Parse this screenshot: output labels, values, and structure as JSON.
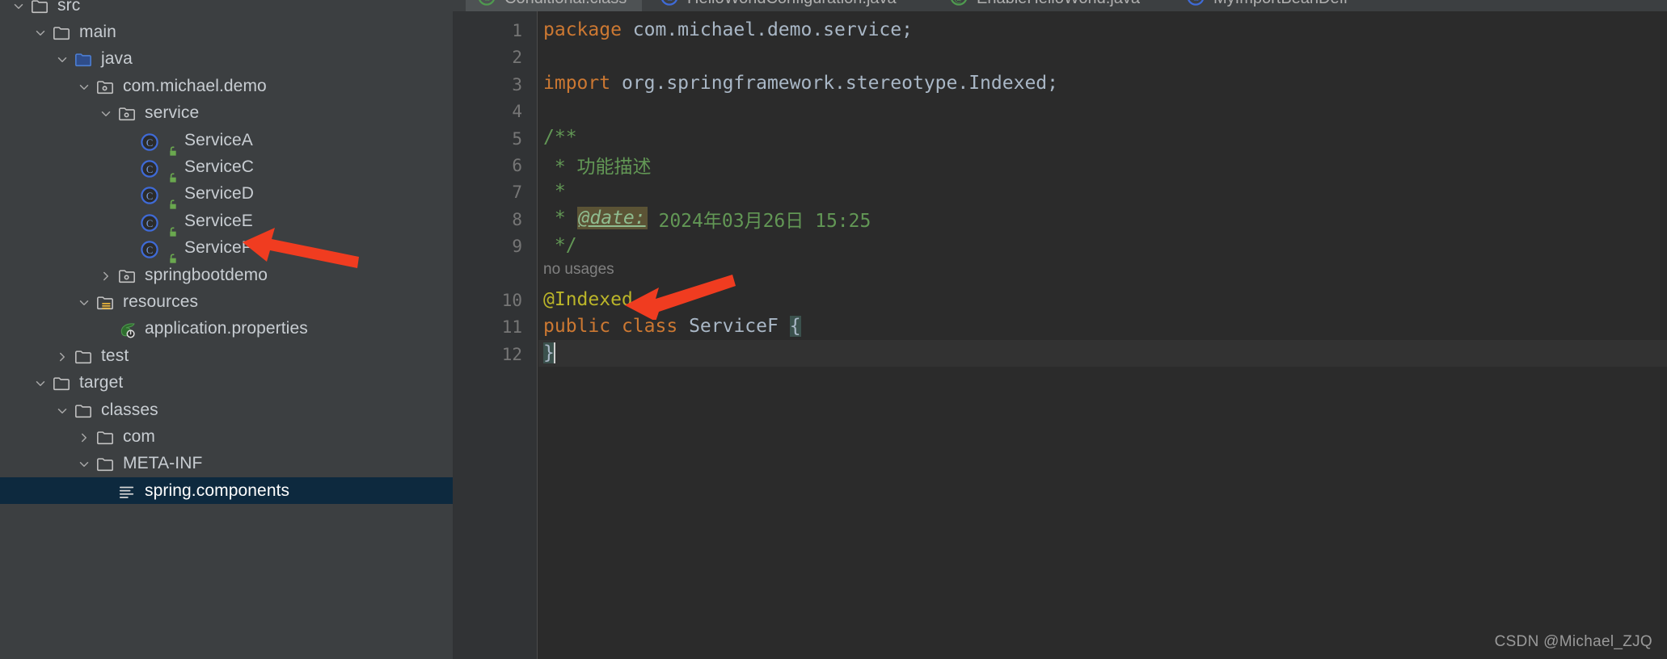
{
  "sidebar": {
    "name": "project-tree",
    "items": [
      {
        "label": "src",
        "indent": 0,
        "chevron": "down",
        "icon": "folder",
        "lock": false,
        "selected": false
      },
      {
        "label": "main",
        "indent": 1,
        "chevron": "down",
        "icon": "folder",
        "lock": false,
        "selected": false
      },
      {
        "label": "java",
        "indent": 2,
        "chevron": "down",
        "icon": "folder-source",
        "lock": false,
        "selected": false
      },
      {
        "label": "com.michael.demo",
        "indent": 3,
        "chevron": "down",
        "icon": "package",
        "lock": false,
        "selected": false
      },
      {
        "label": "service",
        "indent": 4,
        "chevron": "down",
        "icon": "package",
        "lock": false,
        "selected": false
      },
      {
        "label": "ServiceA",
        "indent": 5,
        "chevron": "none",
        "icon": "java-class",
        "lock": true,
        "selected": false
      },
      {
        "label": "ServiceC",
        "indent": 5,
        "chevron": "none",
        "icon": "java-class",
        "lock": true,
        "selected": false
      },
      {
        "label": "ServiceD",
        "indent": 5,
        "chevron": "none",
        "icon": "java-class",
        "lock": true,
        "selected": false
      },
      {
        "label": "ServiceE",
        "indent": 5,
        "chevron": "none",
        "icon": "java-class",
        "lock": true,
        "selected": false
      },
      {
        "label": "ServiceF",
        "indent": 5,
        "chevron": "none",
        "icon": "java-class",
        "lock": true,
        "selected": false
      },
      {
        "label": "springbootdemo",
        "indent": 4,
        "chevron": "right",
        "icon": "package",
        "lock": false,
        "selected": false
      },
      {
        "label": "resources",
        "indent": 3,
        "chevron": "down",
        "icon": "folder-resource",
        "lock": false,
        "selected": false
      },
      {
        "label": "application.properties",
        "indent": 4,
        "chevron": "none",
        "icon": "spring-leaf",
        "lock": false,
        "selected": false
      },
      {
        "label": "test",
        "indent": 2,
        "chevron": "right",
        "icon": "folder",
        "lock": false,
        "selected": false
      },
      {
        "label": "target",
        "indent": 1,
        "chevron": "down",
        "icon": "folder",
        "lock": false,
        "selected": false
      },
      {
        "label": "classes",
        "indent": 2,
        "chevron": "down",
        "icon": "folder",
        "lock": false,
        "selected": false
      },
      {
        "label": "com",
        "indent": 3,
        "chevron": "right",
        "icon": "folder",
        "lock": false,
        "selected": false
      },
      {
        "label": "META-INF",
        "indent": 3,
        "chevron": "down",
        "icon": "folder",
        "lock": false,
        "selected": false
      },
      {
        "label": "spring.components",
        "indent": 4,
        "chevron": "none",
        "icon": "text-file",
        "lock": false,
        "selected": true
      }
    ]
  },
  "editor": {
    "tabs": [
      {
        "label": "Conditional.class",
        "icon": "class-file-icon",
        "active": true
      },
      {
        "label": "HelloWorldConfiguration.java",
        "icon": "java-class-icon",
        "active": false
      },
      {
        "label": "EnableHelloWorld.java",
        "icon": "annotation-icon",
        "active": false
      },
      {
        "label": "MyImportBeanDefi",
        "icon": "java-class-icon",
        "active": false
      }
    ],
    "line_numbers": [
      "1",
      "2",
      "3",
      "4",
      "5",
      "6",
      "7",
      "8",
      "9",
      "10",
      "11",
      "12"
    ],
    "inlay_hint": "no usages",
    "code": {
      "l1_kw": "package",
      "l1_rest": " com.michael.demo.service;",
      "l3_kw": "import",
      "l3_rest": " org.springframework.stereotype.Indexed;",
      "l5": "/**",
      "l6": " * 功能描述",
      "l7": " *",
      "l8_pre": " * ",
      "l8_tag": "@date:",
      "l8_val": " 2024年03月26日 15:25",
      "l9": " */",
      "l10_annotation": "@Indexed",
      "l11_kw1": "public",
      "l11_kw2": "class",
      "l11_name": "ServiceF",
      "l11_brace": "{",
      "l12_brace": "}"
    }
  },
  "watermark": {
    "text": "CSDN @Michael_ZJQ"
  },
  "annotations": {
    "arrow_servicef": "red-arrow-pointing-to-ServiceF",
    "arrow_indexed": "red-arrow-pointing-to-Indexed"
  },
  "colors": {
    "sidebar_bg": "#3c3f41",
    "editor_bg": "#2b2b2b",
    "gutter_bg": "#313335",
    "selection": "#0d293e",
    "keyword": "#cc7832",
    "comment": "#629755",
    "annotation": "#bbb529",
    "text": "#a9b7c6",
    "arrow": "#f03c20"
  }
}
